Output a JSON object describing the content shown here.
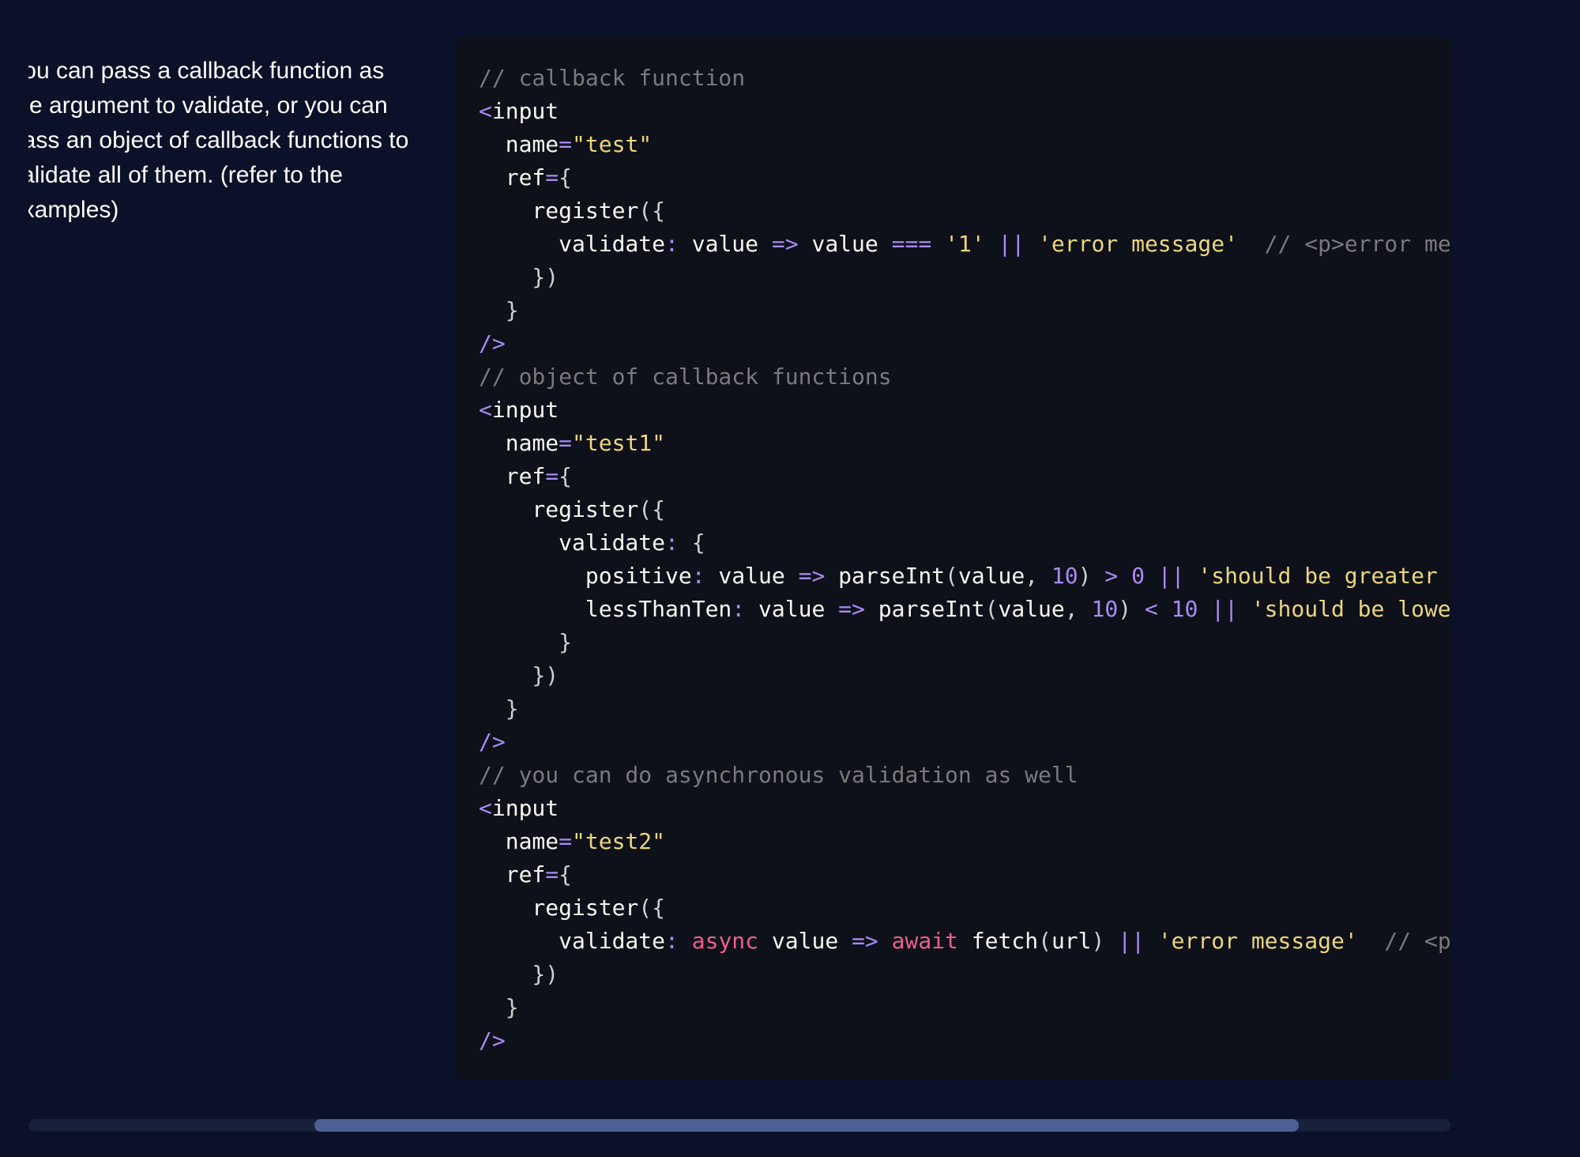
{
  "description": {
    "lines": [
      "You can pass a callback function as",
      "the argument to validate, or you can",
      "pass an object of callback functions to",
      "validate all of them. (refer to the",
      "examples)"
    ]
  },
  "code": {
    "lines": [
      [
        {
          "t": "// callback function",
          "k": "comment"
        }
      ],
      [
        {
          "t": "<",
          "k": "op"
        },
        {
          "t": "input",
          "k": "ident"
        }
      ],
      [
        {
          "t": "  name",
          "k": "ident"
        },
        {
          "t": "=",
          "k": "op"
        },
        {
          "t": "\"test\"",
          "k": "string"
        }
      ],
      [
        {
          "t": "  ref",
          "k": "ident"
        },
        {
          "t": "=",
          "k": "op"
        },
        {
          "t": "{",
          "k": "punct"
        }
      ],
      [
        {
          "t": "    register",
          "k": "ident"
        },
        {
          "t": "({",
          "k": "punct"
        }
      ],
      [
        {
          "t": "      validate",
          "k": "ident"
        },
        {
          "t": ":",
          "k": "op"
        },
        {
          "t": " value ",
          "k": "ident"
        },
        {
          "t": "=>",
          "k": "op"
        },
        {
          "t": " value ",
          "k": "ident"
        },
        {
          "t": "===",
          "k": "op"
        },
        {
          "t": " ",
          "k": "ident"
        },
        {
          "t": "'1'",
          "k": "string"
        },
        {
          "t": " ",
          "k": "ident"
        },
        {
          "t": "||",
          "k": "op"
        },
        {
          "t": " ",
          "k": "ident"
        },
        {
          "t": "'error message'",
          "k": "string"
        },
        {
          "t": "  // <p>error me",
          "k": "comment"
        }
      ],
      [
        {
          "t": "    })",
          "k": "punct"
        }
      ],
      [
        {
          "t": "  }",
          "k": "punct"
        }
      ],
      [
        {
          "t": "/>",
          "k": "op"
        }
      ],
      [
        {
          "t": "// object of callback functions",
          "k": "comment"
        }
      ],
      [
        {
          "t": "<",
          "k": "op"
        },
        {
          "t": "input",
          "k": "ident"
        }
      ],
      [
        {
          "t": "  name",
          "k": "ident"
        },
        {
          "t": "=",
          "k": "op"
        },
        {
          "t": "\"test1\"",
          "k": "string"
        }
      ],
      [
        {
          "t": "  ref",
          "k": "ident"
        },
        {
          "t": "=",
          "k": "op"
        },
        {
          "t": "{",
          "k": "punct"
        }
      ],
      [
        {
          "t": "    register",
          "k": "ident"
        },
        {
          "t": "({",
          "k": "punct"
        }
      ],
      [
        {
          "t": "      validate",
          "k": "ident"
        },
        {
          "t": ":",
          "k": "op"
        },
        {
          "t": " {",
          "k": "punct"
        }
      ],
      [
        {
          "t": "        positive",
          "k": "ident"
        },
        {
          "t": ":",
          "k": "op"
        },
        {
          "t": " value ",
          "k": "ident"
        },
        {
          "t": "=>",
          "k": "op"
        },
        {
          "t": " parseInt",
          "k": "ident"
        },
        {
          "t": "(",
          "k": "punct"
        },
        {
          "t": "value",
          "k": "ident"
        },
        {
          "t": ", ",
          "k": "punct"
        },
        {
          "t": "10",
          "k": "number"
        },
        {
          "t": ") ",
          "k": "punct"
        },
        {
          "t": ">",
          "k": "op"
        },
        {
          "t": " ",
          "k": "ident"
        },
        {
          "t": "0",
          "k": "number"
        },
        {
          "t": " ",
          "k": "ident"
        },
        {
          "t": "||",
          "k": "op"
        },
        {
          "t": " ",
          "k": "ident"
        },
        {
          "t": "'should be greater",
          "k": "string"
        }
      ],
      [
        {
          "t": "        lessThanTen",
          "k": "ident"
        },
        {
          "t": ":",
          "k": "op"
        },
        {
          "t": " value ",
          "k": "ident"
        },
        {
          "t": "=>",
          "k": "op"
        },
        {
          "t": " parseInt",
          "k": "ident"
        },
        {
          "t": "(",
          "k": "punct"
        },
        {
          "t": "value",
          "k": "ident"
        },
        {
          "t": ", ",
          "k": "punct"
        },
        {
          "t": "10",
          "k": "number"
        },
        {
          "t": ") ",
          "k": "punct"
        },
        {
          "t": "<",
          "k": "op"
        },
        {
          "t": " ",
          "k": "ident"
        },
        {
          "t": "10",
          "k": "number"
        },
        {
          "t": " ",
          "k": "ident"
        },
        {
          "t": "||",
          "k": "op"
        },
        {
          "t": " ",
          "k": "ident"
        },
        {
          "t": "'should be lowe",
          "k": "string"
        }
      ],
      [
        {
          "t": "      }",
          "k": "punct"
        }
      ],
      [
        {
          "t": "    })",
          "k": "punct"
        }
      ],
      [
        {
          "t": "  }",
          "k": "punct"
        }
      ],
      [
        {
          "t": "/>",
          "k": "op"
        }
      ],
      [
        {
          "t": "// you can do asynchronous validation as well",
          "k": "comment"
        }
      ],
      [
        {
          "t": "<",
          "k": "op"
        },
        {
          "t": "input",
          "k": "ident"
        }
      ],
      [
        {
          "t": "  name",
          "k": "ident"
        },
        {
          "t": "=",
          "k": "op"
        },
        {
          "t": "\"test2\"",
          "k": "string"
        }
      ],
      [
        {
          "t": "  ref",
          "k": "ident"
        },
        {
          "t": "=",
          "k": "op"
        },
        {
          "t": "{",
          "k": "punct"
        }
      ],
      [
        {
          "t": "    register",
          "k": "ident"
        },
        {
          "t": "({",
          "k": "punct"
        }
      ],
      [
        {
          "t": "      validate",
          "k": "ident"
        },
        {
          "t": ":",
          "k": "op"
        },
        {
          "t": " ",
          "k": "ident"
        },
        {
          "t": "async",
          "k": "keyword"
        },
        {
          "t": " value ",
          "k": "ident"
        },
        {
          "t": "=>",
          "k": "op"
        },
        {
          "t": " ",
          "k": "ident"
        },
        {
          "t": "await",
          "k": "keyword"
        },
        {
          "t": " fetch",
          "k": "ident"
        },
        {
          "t": "(",
          "k": "punct"
        },
        {
          "t": "url",
          "k": "ident"
        },
        {
          "t": ") ",
          "k": "punct"
        },
        {
          "t": "||",
          "k": "op"
        },
        {
          "t": " ",
          "k": "ident"
        },
        {
          "t": "'error message'",
          "k": "string"
        },
        {
          "t": "  // <p",
          "k": "comment"
        }
      ],
      [
        {
          "t": "    })",
          "k": "punct"
        }
      ],
      [
        {
          "t": "  }",
          "k": "punct"
        }
      ],
      [
        {
          "t": "/>",
          "k": "op"
        }
      ]
    ]
  },
  "colors": {
    "page_background": "#0a1128",
    "code_background": "#0e111a",
    "comment": "#7a7a7a",
    "string": "#ecd67c",
    "operator": "#a98bf5",
    "keyword": "#ec5f8c",
    "text": "#f8f8f2",
    "scrollbar_track": "#18213a",
    "scrollbar_thumb": "#4d5f97"
  }
}
